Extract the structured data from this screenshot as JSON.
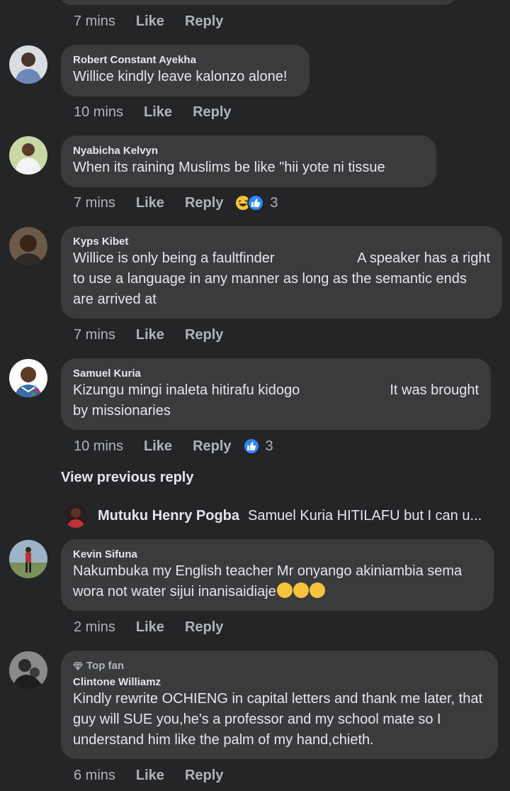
{
  "top_meta": {
    "time": "7 mins",
    "like": "Like",
    "reply": "Reply"
  },
  "comments": [
    {
      "author": "Robert Constant Ayekha",
      "text": "Willice kindly leave kalonzo alone!",
      "time": "10 mins",
      "like": "Like",
      "reply": "Reply"
    },
    {
      "author": "Nyabicha Kelvyn",
      "text": "When its raining Muslims be like \"hii yote ni tissue",
      "time": "7 mins",
      "like": "Like",
      "reply": "Reply",
      "reaction_count": "3",
      "reactions": [
        "haha-icon",
        "like-icon"
      ]
    },
    {
      "author": "Kyps Kibet",
      "text_line1_left": "Willice is only being a faultfinder",
      "text_line1_right": "A speaker has a right",
      "text_rest": "to use a language in any manner as long as the semantic ends are arrived at",
      "time": "7 mins",
      "like": "Like",
      "reply": "Reply"
    },
    {
      "author": "Samuel Kuria",
      "text_line1_left": "Kizungu mingi inaleta hitirafu kidogo",
      "text_line1_right": "It was brought",
      "text_rest": "by missionaries",
      "time": "10 mins",
      "like": "Like",
      "reply": "Reply",
      "reaction_count": "3",
      "reactions": [
        "like-icon"
      ]
    },
    {
      "author": "Kevin Sifuna",
      "text_line1": "Nakumbuka my English teacher Mr onyango akiniambia sema",
      "text_line2": "wora not water sijui inanisaidiaje",
      "time": "2 mins",
      "like": "Like",
      "reply": "Reply"
    },
    {
      "badge": "Top fan",
      "author": "Clintone Williamz",
      "text": "Kindly rewrite OCHIENG in capital letters and thank me later, that guy will SUE you,he's a professor and my school mate so I understand him like the palm of my hand,chieth.",
      "time": "6 mins",
      "like": "Like",
      "reply": "Reply"
    }
  ],
  "view_previous_reply": "View previous reply",
  "reply_preview": {
    "author": "Mutuku Henry Pogba",
    "text": "Samuel Kuria HITILAFU but I can u..."
  },
  "colors": {
    "background": "#242526",
    "bubble": "#3a3b3c",
    "text": "#e4e6eb",
    "secondary": "#b0b3b8",
    "like_blue": "#2d88ff",
    "haha_yellow": "#f7c33c"
  }
}
